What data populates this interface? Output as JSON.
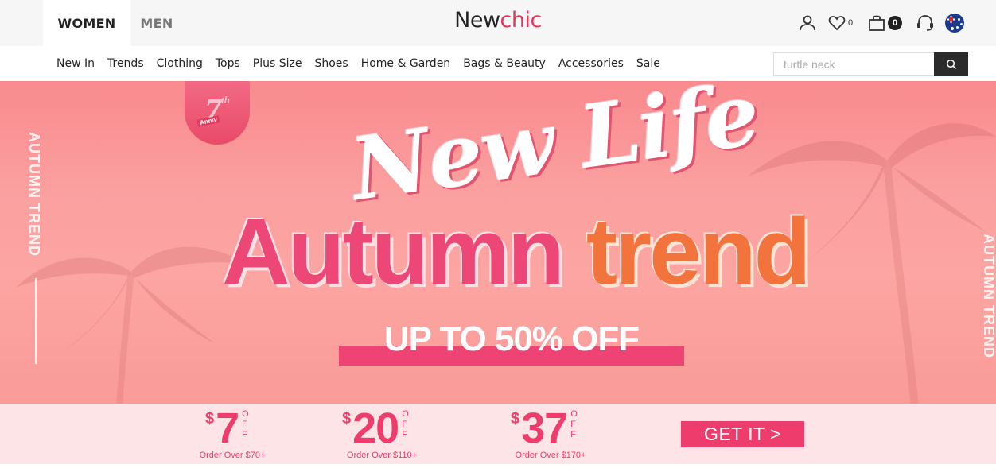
{
  "header": {
    "tabs": [
      {
        "label": "WOMEN",
        "active": true
      },
      {
        "label": "MEN",
        "active": false
      }
    ],
    "logo": {
      "part1": "New",
      "part2": "chic"
    },
    "wishlist_count": "0",
    "cart_count": "0",
    "icons": [
      "user-icon",
      "heart-icon",
      "bag-icon",
      "headset-icon",
      "flag-icon"
    ],
    "brand_color": "#e8345a"
  },
  "nav": {
    "items": [
      "New In",
      "Trends",
      "Clothing",
      "Tops",
      "Plus Size",
      "Shoes",
      "Home & Garden",
      "Bags & Beauty",
      "Accessories",
      "Sale"
    ],
    "search_placeholder": "turtle neck"
  },
  "banner": {
    "side_left": "AUTUMN TREND",
    "side_right": "AUTUMN TREND",
    "anniv_num": "7",
    "anniv_sup": "th",
    "anniv_label": "Anniv",
    "script_title": "New Life",
    "headline_1": "Autumn",
    "headline_2": "trend",
    "offer": "UP TO 50% OFF"
  },
  "coupons": [
    {
      "currency": "$",
      "value": "7",
      "off": [
        "O",
        "F",
        "F"
      ],
      "condition": "Order Over $70+"
    },
    {
      "currency": "$",
      "value": "20",
      "off": [
        "O",
        "F",
        "F"
      ],
      "condition": "Order Over $110+"
    },
    {
      "currency": "$",
      "value": "37",
      "off": [
        "O",
        "F",
        "F"
      ],
      "condition": "Order Over $170+"
    }
  ],
  "cta": {
    "label": "GET IT >"
  }
}
